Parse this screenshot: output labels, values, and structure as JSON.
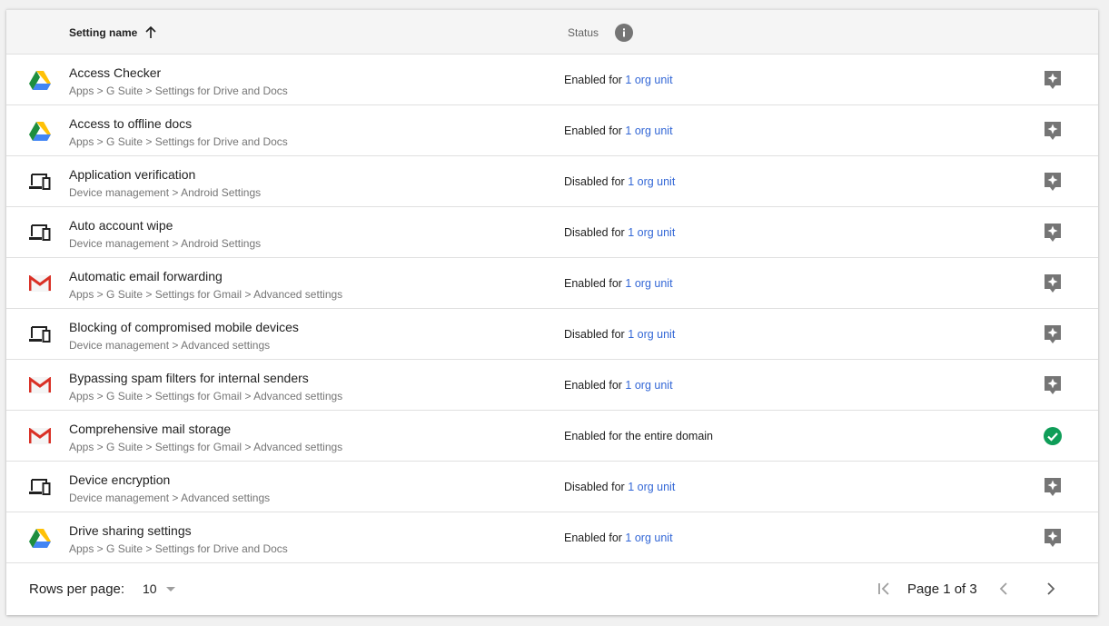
{
  "table": {
    "header": {
      "setting_name": "Setting name",
      "status": "Status"
    },
    "rows": [
      {
        "title": "Access Checker",
        "path": "Apps > G Suite > Settings for Drive and Docs",
        "icon": "drive-icon",
        "status_prefix": "Enabled for ",
        "status_link": "1 org unit",
        "action": "star-badge-icon"
      },
      {
        "title": "Access to offline docs",
        "path": "Apps > G Suite > Settings for Drive and Docs",
        "icon": "drive-icon",
        "status_prefix": "Enabled for ",
        "status_link": "1 org unit",
        "action": "star-badge-icon"
      },
      {
        "title": "Application verification",
        "path": "Device management > Android Settings",
        "icon": "devices-icon",
        "status_prefix": "Disabled for ",
        "status_link": "1 org unit",
        "action": "star-badge-icon"
      },
      {
        "title": "Auto account wipe",
        "path": "Device management > Android Settings",
        "icon": "devices-icon",
        "status_prefix": "Disabled for ",
        "status_link": "1 org unit",
        "action": "star-badge-icon"
      },
      {
        "title": "Automatic email forwarding",
        "path": "Apps > G Suite > Settings for Gmail > Advanced settings",
        "icon": "gmail-icon",
        "status_prefix": "Enabled for ",
        "status_link": "1 org unit",
        "action": "star-badge-icon"
      },
      {
        "title": "Blocking of compromised mobile devices",
        "path": "Device management > Advanced settings",
        "icon": "devices-icon",
        "status_prefix": "Disabled for ",
        "status_link": "1 org unit",
        "action": "star-badge-icon"
      },
      {
        "title": "Bypassing spam filters for internal senders",
        "path": "Apps > G Suite > Settings for Gmail > Advanced settings",
        "icon": "gmail-icon",
        "status_prefix": "Enabled for ",
        "status_link": "1 org unit",
        "action": "star-badge-icon"
      },
      {
        "title": "Comprehensive mail storage",
        "path": "Apps > G Suite > Settings for Gmail > Advanced settings",
        "icon": "gmail-icon",
        "status_prefix": "Enabled for the entire domain",
        "status_link": "",
        "action": "check-circle-icon"
      },
      {
        "title": "Device encryption",
        "path": "Device management > Advanced settings",
        "icon": "devices-icon",
        "status_prefix": "Disabled for ",
        "status_link": "1 org unit",
        "action": "star-badge-icon"
      },
      {
        "title": "Drive sharing settings",
        "path": "Apps > G Suite > Settings for Drive and Docs",
        "icon": "drive-icon",
        "status_prefix": "Enabled for ",
        "status_link": "1 org unit",
        "action": "star-badge-icon"
      }
    ]
  },
  "footer": {
    "rows_per_page_label": "Rows per page:",
    "rows_per_page_value": "10",
    "page_text": "Page 1 of 3"
  },
  "colors": {
    "link": "#3367d6",
    "success": "#0f9d58",
    "badge": "#757575"
  }
}
